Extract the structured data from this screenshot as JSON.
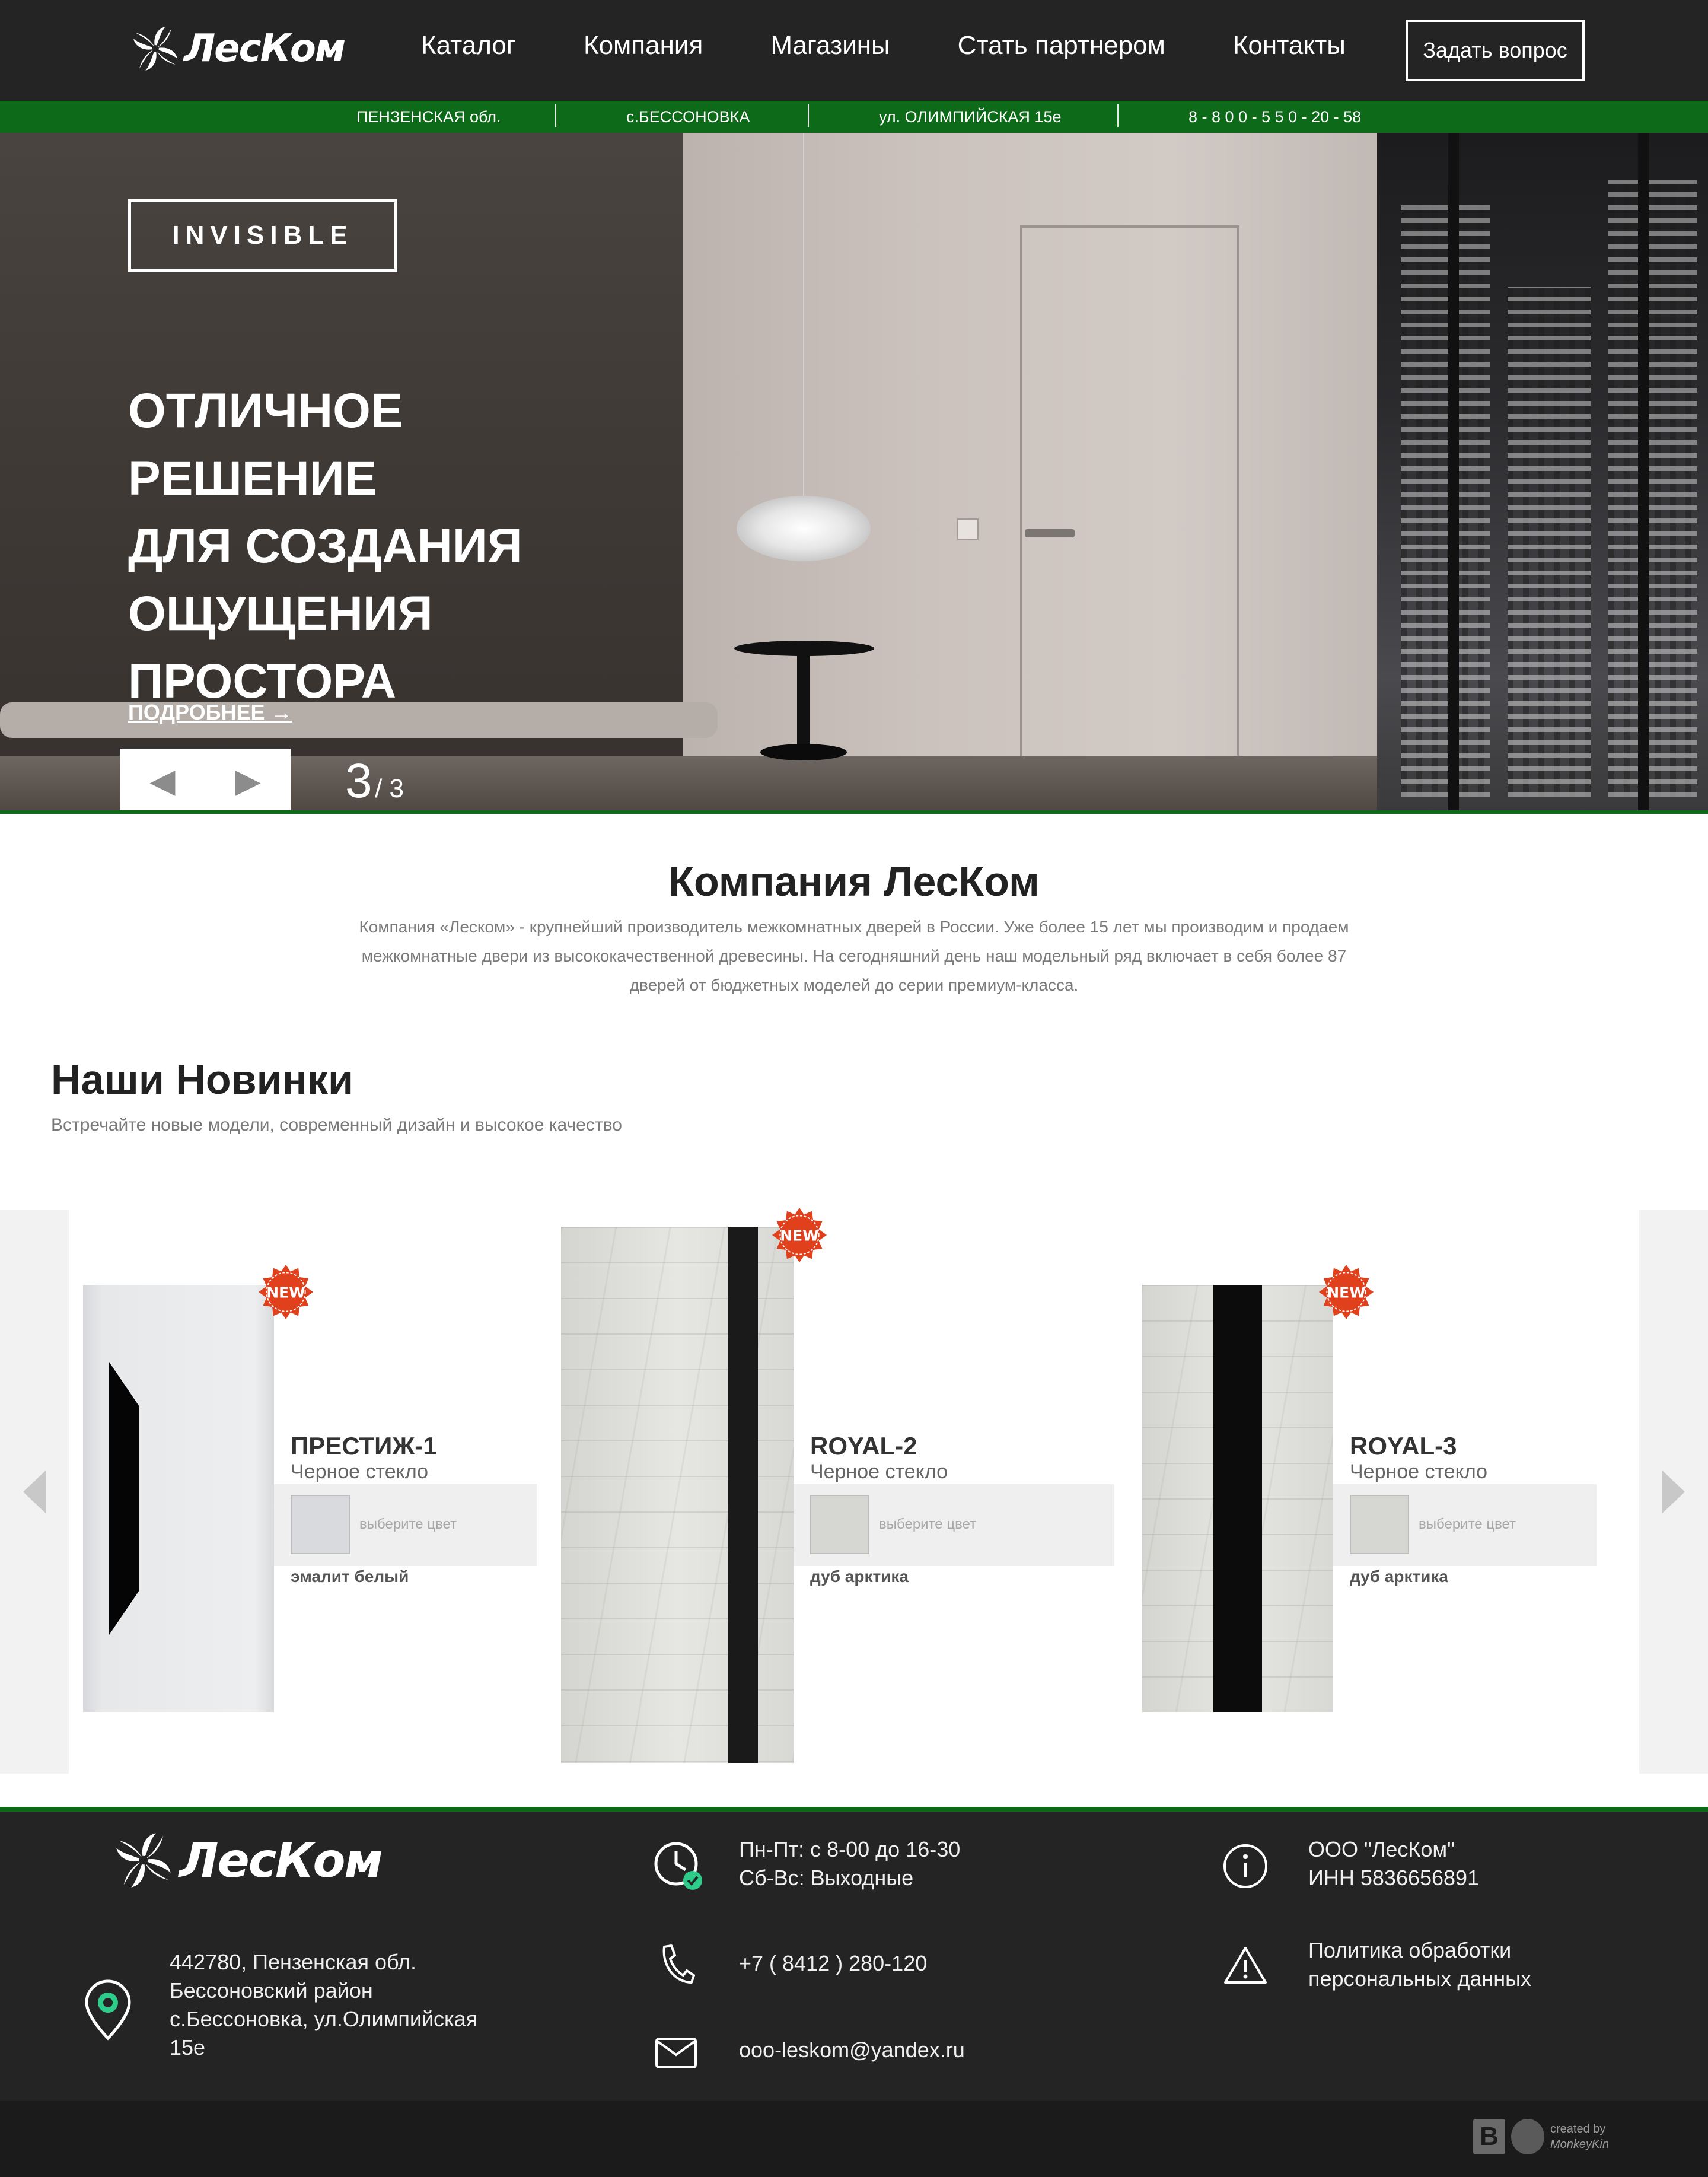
{
  "header": {
    "logo_text": "ЛесКом",
    "nav": [
      "Каталог",
      "Компания",
      "Магазины",
      "Стать партнером",
      "Контакты"
    ],
    "ask_button": "Задать вопрос"
  },
  "infobar": {
    "region": "ПЕНЗЕНСКАЯ обл.",
    "village": "с.БЕССОНОВКА",
    "street": "ул. ОЛИМПИЙСКАЯ 15е",
    "phone": "8 - 8 0 0 - 5 5 0 - 20 - 58"
  },
  "hero": {
    "badge": "INVISIBLE",
    "title_lines": [
      "ОТЛИЧНОЕ РЕШЕНИЕ",
      "ДЛЯ СОЗДАНИЯ",
      "ОЩУЩЕНИЯ",
      "ПРОСТОРА"
    ],
    "more": "ПОДРОБНЕЕ →",
    "prev_glyph": "◀",
    "next_glyph": "▶",
    "slide_current": "3",
    "slide_total": "/ 3"
  },
  "about": {
    "title": "Компания ЛесКом",
    "text": "Компания «Леском» - крупнейший производитель межкомнатных дверей в России. Уже более 15 лет мы производим и продаем межкомнатные двери из высококачественной древесины. На сегодняшний день наш модельный ряд включает в себя более 87 дверей от бюджетных моделей до серии премиум-класса."
  },
  "new_items": {
    "title": "Наши Новинки",
    "subtitle": "Встречайте новые модели, современный дизайн и высокое качество",
    "badge_text": "NEW",
    "products": [
      {
        "name": "ПРЕСТИЖ-1",
        "glass": "Черное стекло",
        "color_hint": "выберите цвет",
        "color_name": "эмалит белый",
        "swatch": "#d8dadd"
      },
      {
        "name": "ROYAL-2",
        "glass": "Черное стекло",
        "color_hint": "выберите цвет",
        "color_name": "дуб арктика",
        "swatch": "#d6d6d2"
      },
      {
        "name": "ROYAL-3",
        "glass": "Черное стекло",
        "color_hint": "выберите цвет",
        "color_name": "дуб арктика",
        "swatch": "#d6d6d2"
      }
    ]
  },
  "footer": {
    "logo_text": "ЛесКом",
    "address": [
      "442780, Пензенская обл.",
      "Бессоновский район",
      "с.Бессоновка, ул.Олимпийская",
      "15е"
    ],
    "hours": [
      "Пн-Пт: с 8-00 до 16-30",
      "Сб-Вс: Выходные"
    ],
    "phone": "+7 ( 8412 ) 280-120",
    "email": "ooo-leskom@yandex.ru",
    "company": [
      "ООО \"ЛесКом\"",
      "ИНН 5836656891"
    ],
    "policy": [
      "Политика обработки",
      "персональных данных"
    ],
    "credit_top": "created by",
    "credit_bottom": "MonkeyKin"
  },
  "colors": {
    "dark": "#242424",
    "green": "#0c6a18",
    "badge_red": "#e0401c",
    "check_green": "#2ecc8a"
  },
  "icons": [
    "logo-mark-icon",
    "location-pin-icon",
    "clock-icon",
    "phone-icon",
    "mail-icon",
    "info-icon",
    "warning-icon",
    "new-badge-icon"
  ]
}
